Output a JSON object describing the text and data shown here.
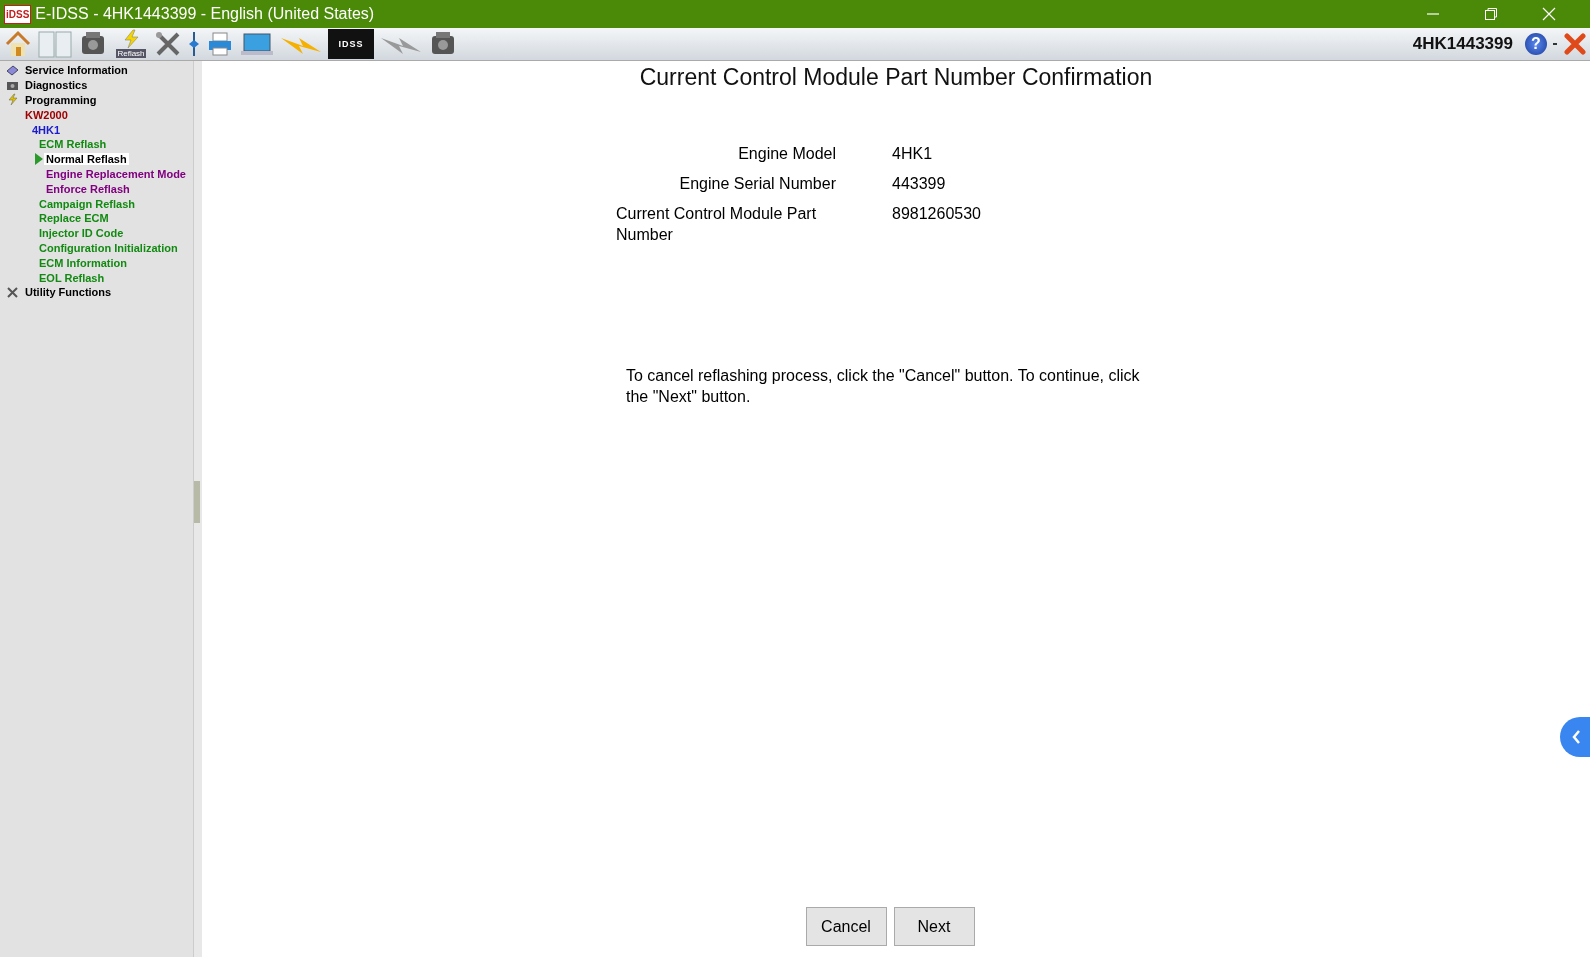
{
  "window": {
    "title": "E-IDSS - 4HK1443399 - English (United States)",
    "app_badge": "iDSS"
  },
  "toolbar": {
    "reflash_label": "Reflash",
    "device_label": "IDSS",
    "vin": "4HK1443399",
    "help": "?"
  },
  "tree": [
    {
      "label": "Service Information",
      "selected": false,
      "color": "#000000"
    },
    {
      "label": "Diagnostics",
      "selected": false,
      "color": "#000000"
    },
    {
      "label": "Programming",
      "selected": false,
      "color": "#000000",
      "children": [
        {
          "label": "KW2000",
          "selected": false,
          "color": "#a00000",
          "children": [
            {
              "label": "4HK1",
              "selected": false,
              "color": "#1a1ad0",
              "children": [
                {
                  "label": "ECM Reflash",
                  "selected": false,
                  "color": "#128a12",
                  "children": [
                    {
                      "label": "Normal Reflash",
                      "selected": true,
                      "color": "#000000"
                    },
                    {
                      "label": "Engine Replacement Mode",
                      "selected": false,
                      "color": "#800080"
                    },
                    {
                      "label": "Enforce Reflash",
                      "selected": false,
                      "color": "#800080"
                    }
                  ]
                },
                {
                  "label": "Campaign Reflash",
                  "selected": false,
                  "color": "#128a12"
                },
                {
                  "label": "Replace ECM",
                  "selected": false,
                  "color": "#128a12"
                },
                {
                  "label": "Injector ID Code",
                  "selected": false,
                  "color": "#128a12"
                },
                {
                  "label": "Configuration Initialization",
                  "selected": false,
                  "color": "#128a12"
                },
                {
                  "label": "ECM Information",
                  "selected": false,
                  "color": "#128a12"
                },
                {
                  "label": "EOL Reflash",
                  "selected": false,
                  "color": "#128a12"
                }
              ]
            }
          ]
        }
      ]
    },
    {
      "label": "Utility Functions",
      "selected": false,
      "color": "#000000"
    }
  ],
  "main": {
    "title": "Current Control Module Part Number Confirmation",
    "fields": [
      {
        "label": "Engine Model",
        "value": "4HK1"
      },
      {
        "label": "Engine Serial Number",
        "value": "443399"
      },
      {
        "label": "Current Control Module Part Number",
        "value": "8981260530"
      }
    ],
    "instruction": "To cancel reflashing process, click the \"Cancel\" button. To continue, click the \"Next\" button.",
    "buttons": [
      "Cancel",
      "Next"
    ]
  }
}
